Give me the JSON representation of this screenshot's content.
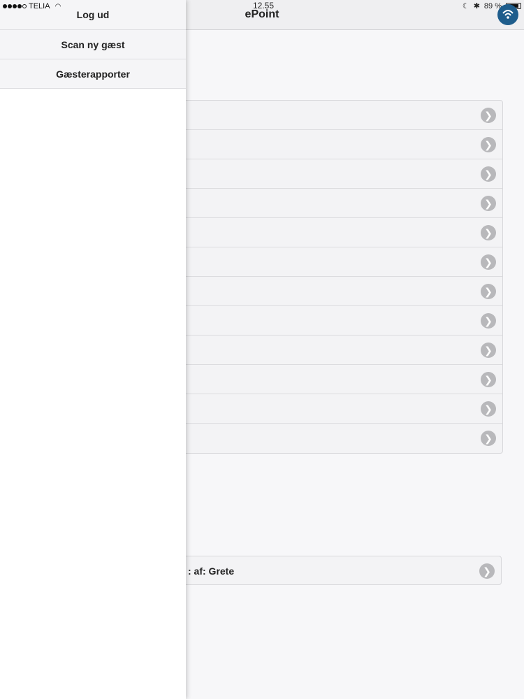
{
  "status_bar": {
    "carrier": "TELIA",
    "time": "12.55",
    "battery_percent": "89 %",
    "battery_level": 0.89
  },
  "navbar": {
    "title": "ePoint",
    "logo_icon": "wifi-globe-icon"
  },
  "side_menu": {
    "items": [
      {
        "label": "Log ud"
      },
      {
        "label": "Scan ny gæst"
      },
      {
        "label": "Gæsterapporter"
      }
    ]
  },
  "list": {
    "row_count": 12,
    "chevron_icon": "chevron-right-icon",
    "chevron_glyph": "❯"
  },
  "bottom_row": {
    "label_fragment": ": af: Grete"
  },
  "colors": {
    "navbar_bg": "#efeff1",
    "row_bg": "#f3f3f5",
    "chevron": "#b8b8bb",
    "logo": "#1e5d8c"
  }
}
